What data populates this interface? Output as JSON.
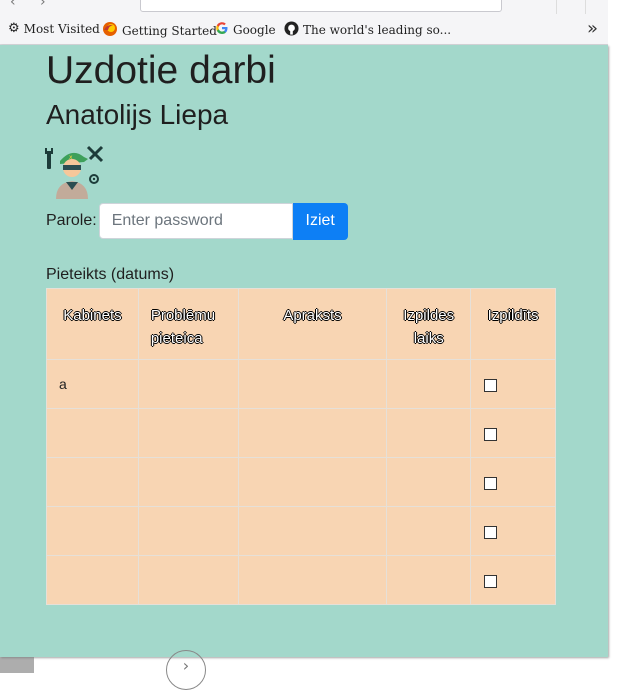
{
  "bookmarks": [
    {
      "label": "Most Visited",
      "icon": "gear-icon"
    },
    {
      "label": "Getting Started",
      "icon": "firefox-icon"
    },
    {
      "label": "Google",
      "icon": "google-icon"
    },
    {
      "label": "The world's leading so...",
      "icon": "github-icon"
    }
  ],
  "page": {
    "title": "Uzdotie darbi",
    "user_name": "Anatolijs Liepa",
    "password_label": "Parole:",
    "password_placeholder": "Enter password",
    "logout_button": "Iziet",
    "table_caption": "Pieteikts (datums)"
  },
  "table": {
    "headers": [
      "Kabinets",
      "Problēmu pieteica",
      "Apraksts",
      "Izpildes laiks",
      "Izpildīts"
    ],
    "rows": [
      [
        "a",
        "",
        "",
        "",
        ""
      ],
      [
        "",
        "",
        "",
        "",
        ""
      ],
      [
        "",
        "",
        "",
        "",
        ""
      ],
      [
        "",
        "",
        "",
        "",
        ""
      ],
      [
        "",
        "",
        "",
        "",
        ""
      ]
    ]
  },
  "colors": {
    "page_background": "#a3d8cb",
    "table_background": "#f8d5b3",
    "button_background": "#0d7ff5"
  }
}
